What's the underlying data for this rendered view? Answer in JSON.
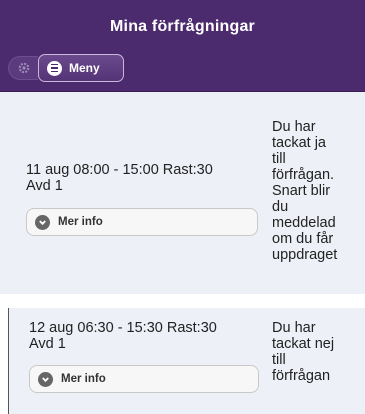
{
  "header": {
    "title": "Mina förfrågningar",
    "settings_icon": "gear-icon",
    "menu_label": "Meny",
    "menu_icon": "hamburger-icon"
  },
  "requests": [
    {
      "shift_line1": "11 aug 08:00 - 15:00 Rast:30",
      "shift_line2": "Avd 1",
      "info_label": "Mer info",
      "info_icon": "chevron-down-icon",
      "status_lines": [
        "Du har",
        "tackat ja",
        "till",
        "förfrågan.",
        "Snart blir",
        "du",
        "meddelad",
        "om du får",
        "uppdraget"
      ]
    },
    {
      "shift_line1": "12 aug 06:30 - 15:30 Rast:30",
      "shift_line2": "Avd 1",
      "info_label": "Mer info",
      "info_icon": "chevron-down-icon",
      "status_lines": [
        "Du har",
        "tackat nej",
        "till",
        "förfrågan"
      ]
    }
  ],
  "colors": {
    "header_bg": "#4b2a6e",
    "card_bg": "#eef0f7"
  }
}
